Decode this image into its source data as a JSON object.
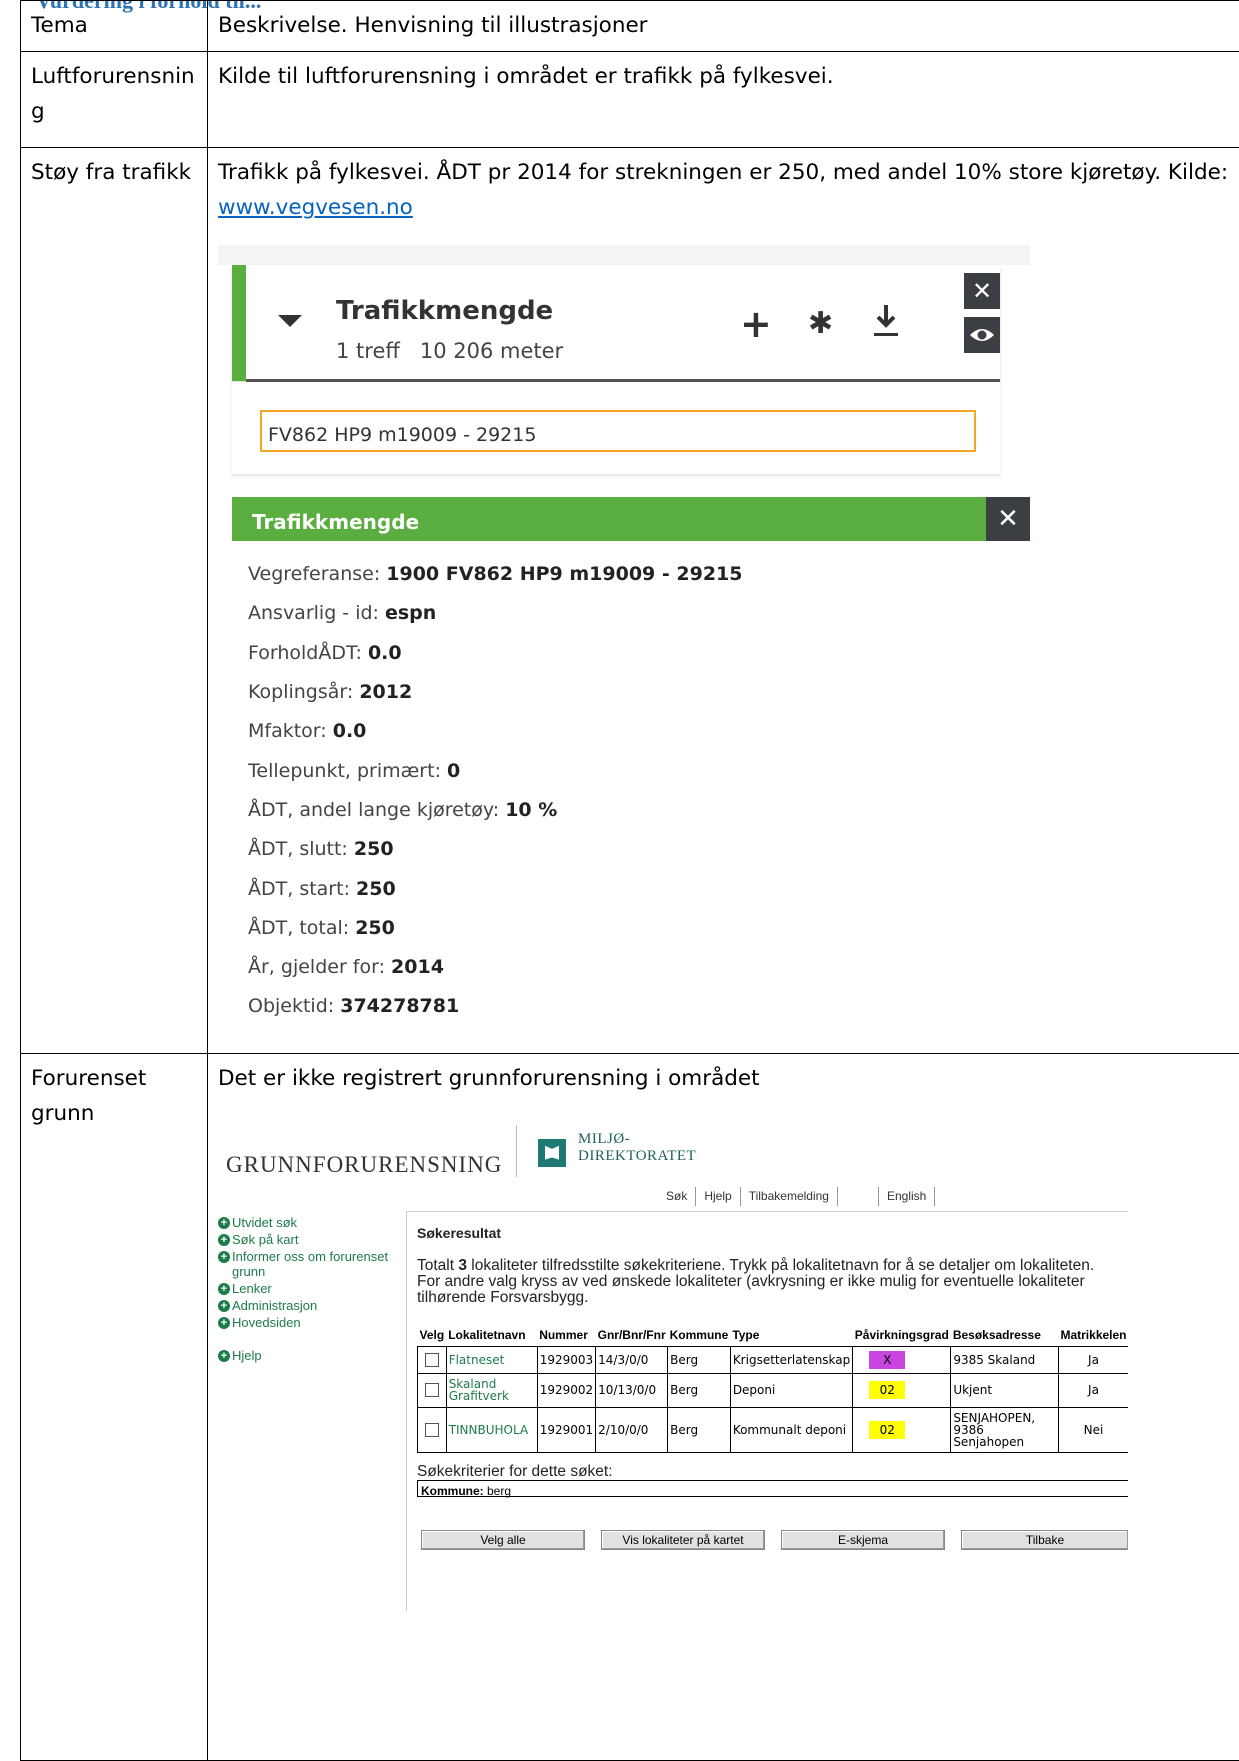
{
  "heading": "Vurdering i forhold til...",
  "table": {
    "header": {
      "col1": "Tema",
      "col2": "Beskrivelse. Henvisning til illustrasjoner"
    },
    "rows": [
      {
        "tema": "Luftforurensnin g",
        "desc": "Kilde til luftforurensning i området er trafikk på fylkesvei."
      },
      {
        "tema": "Støy fra trafikk",
        "desc": "Trafikk på fylkesvei. ÅDT pr 2014 for strekningen er 250, med andel 10% store kjøretøy. Kilde: ",
        "link": "www.vegvesen.no"
      },
      {
        "tema": "Forurenset grunn",
        "desc": "Det er ikke registrert grunnforurensning i området"
      }
    ]
  },
  "vegvesen": {
    "panel_title": "Trafikkmengde",
    "panel_sub": "1 treff   10 206 meter",
    "icons": [
      "caret-down-icon",
      "plus-icon",
      "gear-icon",
      "download-icon",
      "close-icon",
      "eye-icon"
    ],
    "search_value": "FV862 HP9 m19009 - 29215",
    "result_title": "Trafikkmengde",
    "attributes": [
      {
        "label": "Vegreferanse: ",
        "value": "1900 FV862 HP9 m19009 - 29215"
      },
      {
        "label": "Ansvarlig - id: ",
        "value": "espn"
      },
      {
        "label": "ForholdÅDT: ",
        "value": "0.0"
      },
      {
        "label": "Koplingsår: ",
        "value": "2012"
      },
      {
        "label": "Mfaktor: ",
        "value": "0.0"
      },
      {
        "label": "Tellepunkt, primært: ",
        "value": "0"
      },
      {
        "label": "ÅDT, andel lange kjøretøy: ",
        "value": "10 %"
      },
      {
        "label": "ÅDT, slutt: ",
        "value": "250"
      },
      {
        "label": "ÅDT, start: ",
        "value": "250"
      },
      {
        "label": "ÅDT, total: ",
        "value": "250"
      },
      {
        "label": "År, gjelder for: ",
        "value": "2014"
      },
      {
        "label": "Objektid: ",
        "value": "374278781"
      }
    ],
    "accent_color": "#5aad3f"
  },
  "grunn": {
    "site_title": "GRUNNFORURENSNING",
    "logo_line1": "MILJØ-",
    "logo_line2": "DIREKTORATET",
    "topnav": [
      "Søk",
      "Hjelp",
      "Tilbakemelding"
    ],
    "english": "English",
    "sidebar": [
      "Utvidet søk",
      "Søk på kart",
      "Informer oss om forurenset grunn",
      "Lenker",
      "Administrasjon",
      "Hovedsiden"
    ],
    "sidebar_help": "Hjelp",
    "main_title": "Søkeresultat",
    "intro_pre": "Totalt ",
    "intro_count": "3",
    "intro_post": " lokaliteter tilfredsstilte søkekriteriene. Trykk på lokalitetnavn for å se detaljer om lokaliteten. For andre valg kryss av ved ønskede lokaliteter (avkrysning er ikke mulig for eventuelle lokaliteter tilhørende Forsvarsbygg.",
    "columns": [
      "Velg",
      "Lokalitetnavn",
      "Nummer",
      "Gnr/Bnr/Fnr",
      "Kommune",
      "Type",
      "Påvirkningsgrad",
      "Besøksadresse",
      "Matrikkelen"
    ],
    "results": [
      {
        "name": "Flatneset",
        "nummer": "1929003",
        "gnr": "14/3/0/0",
        "kommune": "Berg",
        "type": "Krigsetterlatenskap",
        "grad": "X",
        "grad_color": "#c845e0",
        "adresse": "9385 Skaland",
        "matr": "Ja"
      },
      {
        "name": "Skaland Grafitverk",
        "nummer": "1929002",
        "gnr": "10/13/0/0",
        "kommune": "Berg",
        "type": "Deponi",
        "grad": "02",
        "grad_color": "#ffff00",
        "adresse": "Ukjent",
        "matr": "Ja"
      },
      {
        "name": "TINNBUHOLA",
        "nummer": "1929001",
        "gnr": "2/10/0/0",
        "kommune": "Berg",
        "type": "Kommunalt deponi",
        "grad": "02",
        "grad_color": "#ffff00",
        "adresse": "SENJAHOPEN, 9386 Senjahopen",
        "matr": "Nei"
      }
    ],
    "criteria_label": "Søkekriterier for dette søket:",
    "criteria_key": "Kommune:",
    "criteria_value": " berg",
    "buttons": [
      "Velg alle",
      "Vis lokaliteter på kartet",
      "E-skjema",
      "Tilbake"
    ],
    "link_color": "#1e7b4a"
  }
}
